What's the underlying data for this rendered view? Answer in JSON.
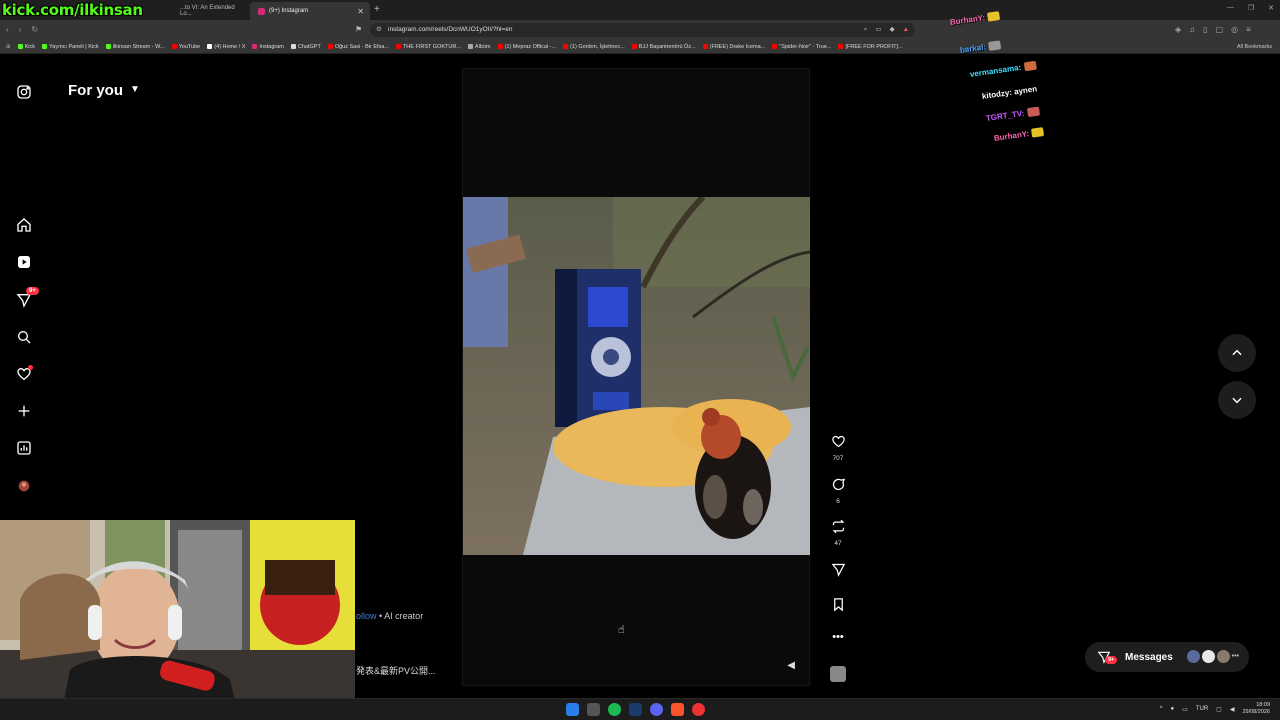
{
  "overlay": {
    "kick_handle": "kick.com/ilkinsan",
    "chat": [
      {
        "user": "BurhanY:",
        "text": "",
        "color": "#ff66b2",
        "emote": "#e6c229"
      },
      {
        "user": "barkal:",
        "text": "",
        "color": "#4aa3ff",
        "emote": "#999999"
      },
      {
        "user": "vermansama:",
        "text": "",
        "color": "#3fe0ff",
        "emote": "#d06a3f"
      },
      {
        "user": "kitodzy:",
        "text": "aynen",
        "color": "#ffffff",
        "emote": ""
      },
      {
        "user": "TGRT_TV:",
        "text": "",
        "color": "#c35cff",
        "emote": "#c85a5a"
      },
      {
        "user": "BurhanY:",
        "text": "",
        "color": "#ff66b2",
        "emote": "#e6c229"
      }
    ]
  },
  "browser": {
    "tabs": [
      {
        "label": "...to VI: An Extended Lo..."
      },
      {
        "label": "(9+) Instagram"
      }
    ],
    "url": "instagram.com/reels/DcnWUO1yOIl/?hl=en",
    "bookmarks": [
      {
        "label": "Kick",
        "color": "#53fc18"
      },
      {
        "label": "Yayıncı Paneli | Kick",
        "color": "#53fc18"
      },
      {
        "label": "ilkinsan Stream - W...",
        "color": "#53fc18"
      },
      {
        "label": "YouTube",
        "color": "#ff0000"
      },
      {
        "label": "(4) Home / X",
        "color": "#ffffff"
      },
      {
        "label": "Instagram",
        "color": "#d62976"
      },
      {
        "label": "ChatGPT",
        "color": "#dddddd"
      },
      {
        "label": "Oğuz Sasi - Bir Efsa...",
        "color": "#ff0000"
      },
      {
        "label": "THE FIRST GOKTUR...",
        "color": "#ff0000"
      },
      {
        "label": "Albüm",
        "color": "#aaaaaa"
      },
      {
        "label": "(1) Mepraz Offical -...",
        "color": "#ff0000"
      },
      {
        "label": "(1) Gordon, İşletmec...",
        "color": "#ff0000"
      },
      {
        "label": "BJJ Başantrenörü Öz...",
        "color": "#ff0000"
      },
      {
        "label": "(FREE) Drake Icema...",
        "color": "#ff0000"
      },
      {
        "label": "\"Spider-Noir\" - True...",
        "color": "#ff0000"
      },
      {
        "label": "[FREE FOR PROFIT]...",
        "color": "#ff0000"
      }
    ],
    "all_bookmarks": "All Bookmarks"
  },
  "instagram": {
    "feed_title": "For you",
    "notification_badge": "9+",
    "likes": "707",
    "comments": "6",
    "reposts": "47",
    "creator_follow": "ollow",
    "creator_tag": " • AI creator",
    "caption": "発表&最新PV公開...",
    "messages_label": "Messages",
    "messages_badge": "9+"
  },
  "taskbar": {
    "lang": "TUR",
    "time": "18:09",
    "date": "29/08/2026"
  },
  "colors": {
    "kick_green": "#53fc18",
    "ig_red": "#ff3040"
  }
}
